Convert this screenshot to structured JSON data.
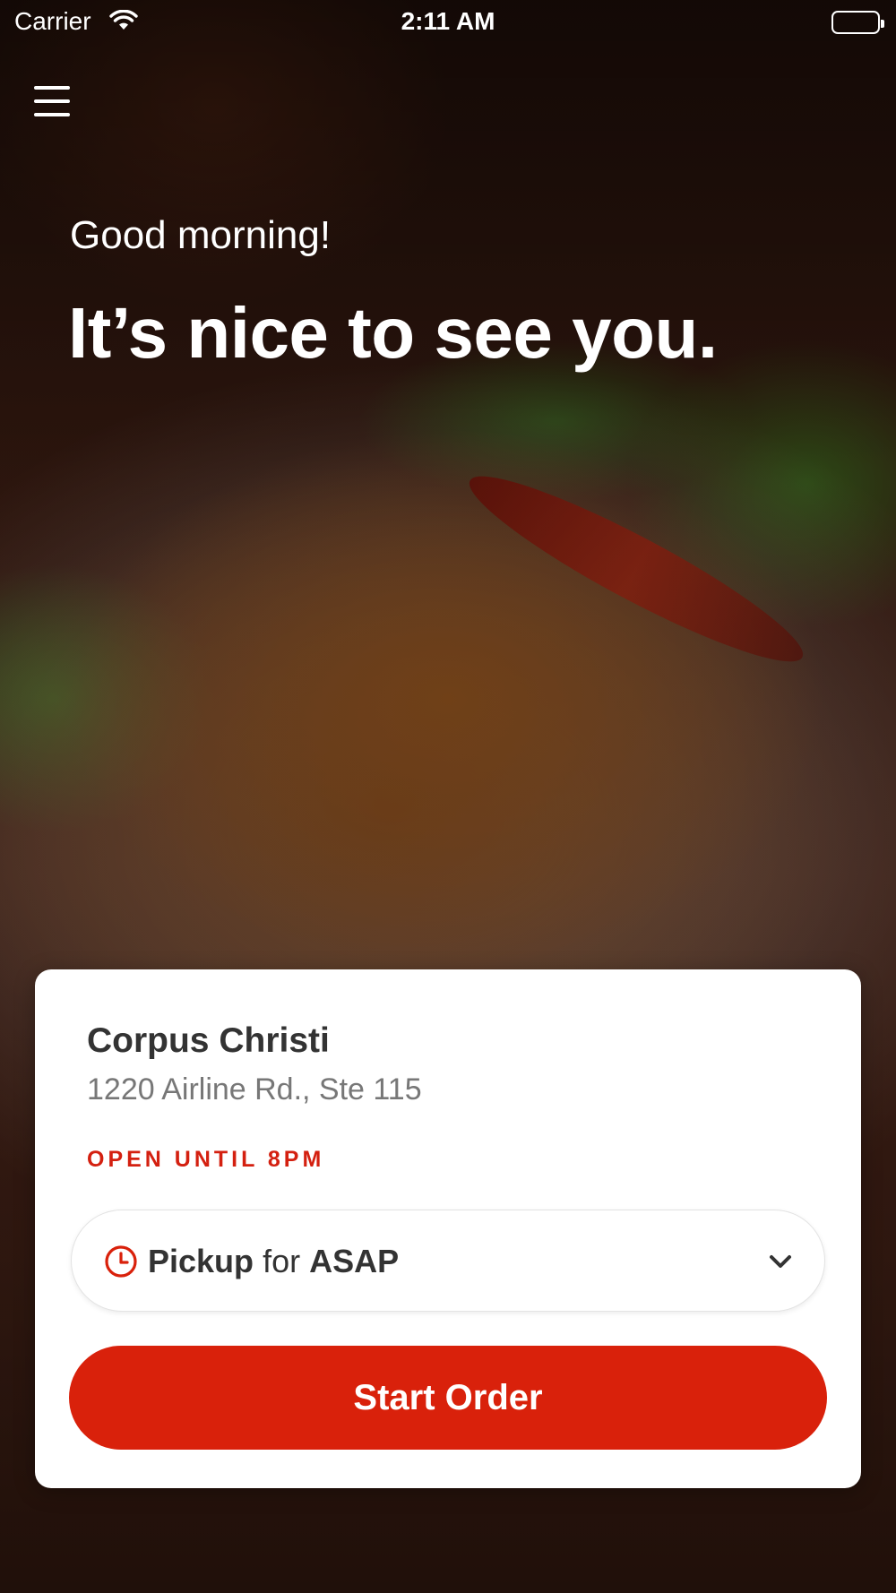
{
  "status_bar": {
    "carrier": "Carrier",
    "time": "2:11 AM",
    "wifi_icon": "wifi-icon",
    "battery_icon": "battery-icon"
  },
  "header": {
    "menu_icon": "hamburger-menu-icon",
    "greeting": "Good morning!",
    "headline": "It’s nice to see you."
  },
  "location_card": {
    "store_name": "Corpus Christi",
    "address": "1220 Airline Rd., Ste 115",
    "hours": "OPEN UNTIL 8PM",
    "order_mode": {
      "icon": "clock-icon",
      "mode": "Pickup",
      "connector": "for",
      "time": "ASAP",
      "chevron_icon": "chevron-down-icon"
    },
    "start_button_label": "Start Order"
  },
  "colors": {
    "accent": "#d9210b",
    "hours_text": "#d42010",
    "card_background": "#ffffff"
  }
}
